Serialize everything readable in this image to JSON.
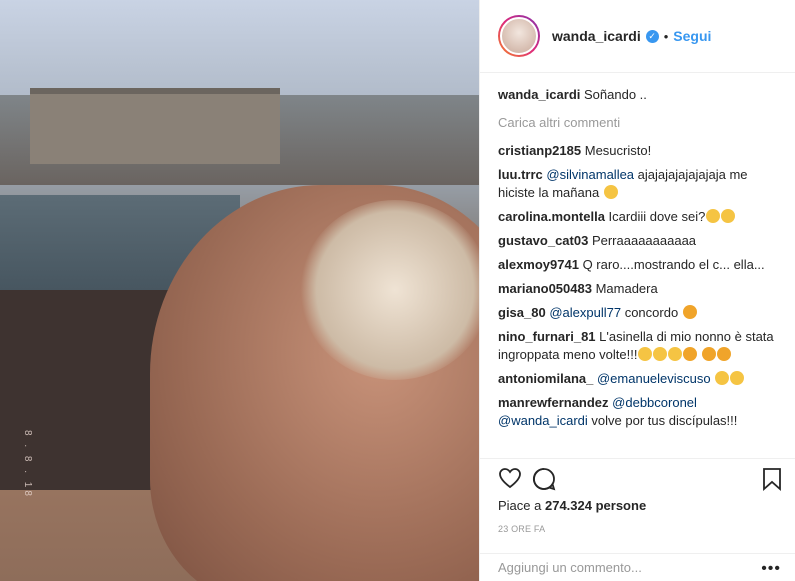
{
  "header": {
    "username": "wanda_icardi",
    "separator": "•",
    "follow_label": "Segui"
  },
  "photo": {
    "timestamp": "8 . 8 . 18"
  },
  "caption": {
    "user": "wanda_icardi",
    "text": "Soñando .."
  },
  "load_more_label": "Carica altri commenti",
  "comments": [
    {
      "user": "cristianp2185",
      "text": "Mesucristo!"
    },
    {
      "user": "luu.trrc",
      "mention": "@silvinamallea",
      "text": " ajajajajajajajaja me hiciste la mañana"
    },
    {
      "user": "carolina.montella",
      "text": "Icardiii dove sei?"
    },
    {
      "user": "gustavo_cat03",
      "text": "Perraaaaaaaaaaa"
    },
    {
      "user": "alexmoy9741",
      "text": "Q raro....mostrando el c... ella..."
    },
    {
      "user": "mariano050483",
      "text": "Mamadera"
    },
    {
      "user": "gisa_80",
      "mention": "@alexpull77",
      "text": " concordo"
    },
    {
      "user": "nino_furnari_81",
      "text": "L'asinella di mio nonno è stata ingroppata meno volte!!!"
    },
    {
      "user": "antoniomilana_",
      "mention": "@emanueleviscuso",
      "text": ""
    },
    {
      "user": "manrewfernandez",
      "mention": "@debbcoronel",
      "text": ""
    },
    {
      "user": "",
      "mention": "@wanda_icardi",
      "text": " volve por tus discípulas!!!"
    }
  ],
  "likes": {
    "prefix": "Piace a ",
    "count": "274.324",
    "suffix": " persone"
  },
  "time_label": "23 ORE FA",
  "add_comment_placeholder": "Aggiungi un commento...",
  "more_label": "•••",
  "icons": {
    "heart": "heart-icon",
    "comment": "comment-icon",
    "save": "bookmark-icon",
    "verified": "verified-badge-icon"
  },
  "colors": {
    "link": "#3897f0",
    "mention": "#003569",
    "muted": "#999999"
  }
}
